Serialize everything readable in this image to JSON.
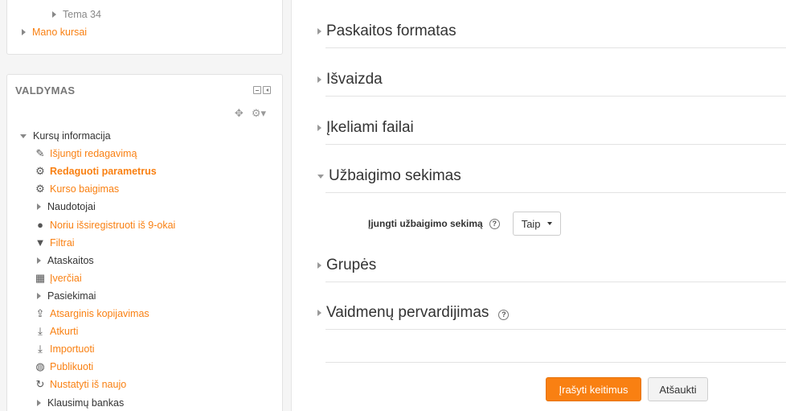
{
  "nav_top": {
    "tema": "Tema 34",
    "my_courses": "Mano kursai"
  },
  "admin": {
    "title": "VALDYMAS",
    "items": [
      {
        "label": "Kursų informacija",
        "type": "expanded"
      },
      {
        "label": "Išjungti redagavimą",
        "type": "link",
        "icon": "pencil-icon"
      },
      {
        "label": "Redaguoti parametrus",
        "type": "link-bold",
        "icon": "gear-icon"
      },
      {
        "label": "Kurso baigimas",
        "type": "link",
        "icon": "gear-icon"
      },
      {
        "label": "Naudotojai",
        "type": "collapsed"
      },
      {
        "label": "Noriu išsiregistruoti iš 9-okai",
        "type": "link",
        "icon": "user-icon"
      },
      {
        "label": "Filtrai",
        "type": "link",
        "icon": "filter-icon"
      },
      {
        "label": "Ataskaitos",
        "type": "collapsed"
      },
      {
        "label": "Įverčiai",
        "type": "link",
        "icon": "table-icon"
      },
      {
        "label": "Pasiekimai",
        "type": "collapsed"
      },
      {
        "label": "Atsarginis kopijavimas",
        "type": "link",
        "icon": "upload-icon"
      },
      {
        "label": "Atkurti",
        "type": "link",
        "icon": "download-icon"
      },
      {
        "label": "Importuoti",
        "type": "link",
        "icon": "download-icon"
      },
      {
        "label": "Publikuoti",
        "type": "link",
        "icon": "globe-icon"
      },
      {
        "label": "Nustatyti iš naujo",
        "type": "link",
        "icon": "reset-icon"
      },
      {
        "label": "Klausimų bankas",
        "type": "collapsed"
      }
    ]
  },
  "sections": {
    "s1": "Paskaitos formatas",
    "s2": "Išvaizda",
    "s3": "Įkeliami failai",
    "s4": "Užbaigimo sekimas",
    "s5": "Grupės",
    "s6": "Vaidmenų pervardijimas"
  },
  "completion": {
    "label": "Įjungti užbaigimo sekimą",
    "value": "Taip"
  },
  "buttons": {
    "save": "Įrašyti keitimus",
    "cancel": "Atšaukti"
  },
  "colors": {
    "link": "#f98012",
    "primary_button": "#f98012"
  }
}
